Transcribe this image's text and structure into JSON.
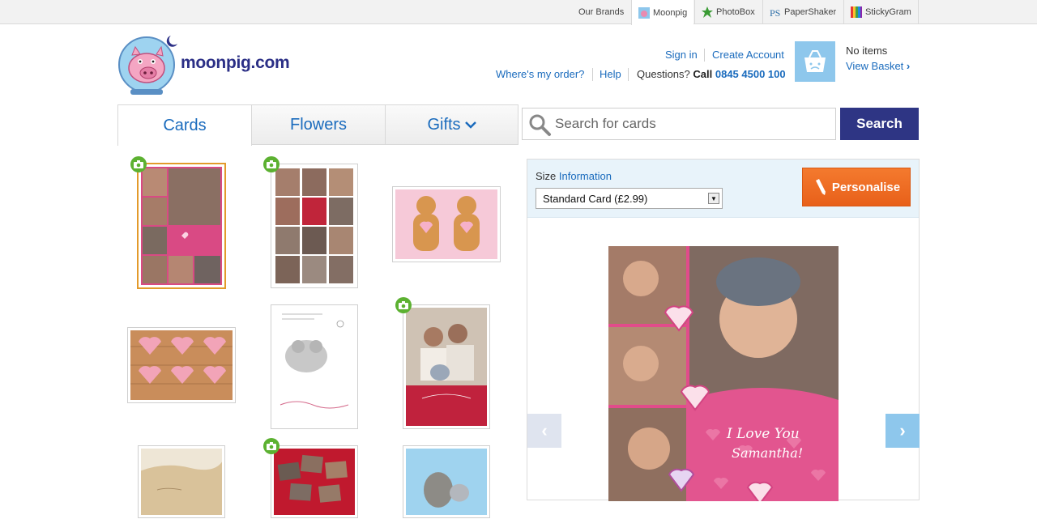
{
  "brandbar": {
    "our_brands": "Our Brands",
    "brands": [
      {
        "label": "Moonpig",
        "icon": "moonpig-icon"
      },
      {
        "label": "PhotoBox",
        "icon": "photobox-icon"
      },
      {
        "label": "PaperShaker",
        "icon": "papershaker-icon"
      },
      {
        "label": "StickyGram",
        "icon": "stickygram-icon"
      }
    ]
  },
  "header": {
    "logo_text": "moonpig.com",
    "sign_in": "Sign in",
    "create_account": "Create Account",
    "wheres_my_order": "Where's my order?",
    "help": "Help",
    "questions": "Questions?",
    "call": "Call",
    "phone": "0845 4500 100",
    "basket_status": "No items",
    "view_basket": "View Basket"
  },
  "tabs": [
    {
      "label": "Cards"
    },
    {
      "label": "Flowers"
    },
    {
      "label": "Gifts"
    }
  ],
  "search": {
    "placeholder": "Search for cards",
    "button_label": "Search"
  },
  "detail": {
    "size_label": "Size",
    "size_info": "Information",
    "size_selected": "Standard Card (£2.99)",
    "personalise_label": "Personalise",
    "card_message_line1": "I Love You",
    "card_message_line2": "Samantha!"
  },
  "colors": {
    "brand_blue": "#2e3584",
    "link_blue": "#1a6bbd",
    "personalise_orange": "#f06d24",
    "photo_badge_green": "#5cb131",
    "selected_border": "#e39a2b",
    "nav_arrow_active": "#8ec7ec"
  }
}
